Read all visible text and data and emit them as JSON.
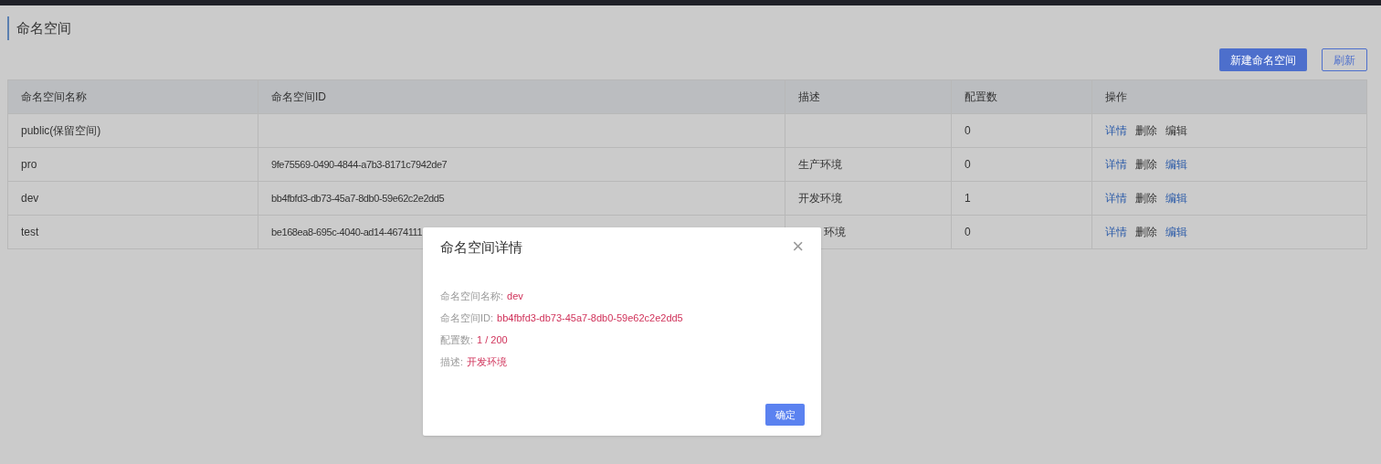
{
  "page": {
    "title": "命名空间"
  },
  "toolbar": {
    "buttons": [
      {
        "label": "新建命名空间",
        "kind": "primary"
      },
      {
        "label": "刷新",
        "kind": "outline"
      }
    ]
  },
  "table": {
    "columns": [
      "命名空间名称",
      "命名空间ID",
      "描述",
      "配置数",
      "操作"
    ],
    "rows": [
      {
        "name": "public(保留空间)",
        "id": "",
        "description": "",
        "count": "0",
        "actions": [
          "详情",
          "删除",
          "编辑"
        ]
      },
      {
        "name": "pro",
        "id": "9fe75569-0490-4844-a7b3-8171c7942de7",
        "description": "生产环境",
        "count": "0",
        "actions": [
          "详情",
          "删除",
          "编辑"
        ]
      },
      {
        "name": "dev",
        "id": "bb4fbfd3-db73-45a7-8db0-59e62c2e2dd5",
        "description": "开发环境",
        "count": "1",
        "actions": [
          "详情",
          "删除",
          "编辑"
        ]
      },
      {
        "name": "test",
        "id": "be168ea8-695c-4040-ad14-4674111",
        "description": "环境",
        "count": "0",
        "actions": [
          "详情",
          "删除",
          "编辑"
        ],
        "covered": true
      }
    ]
  },
  "dialog": {
    "title": "命名空间详情",
    "close": "×",
    "fields": [
      {
        "label": "命名空间名称:",
        "value": "dev"
      },
      {
        "label": "命名空间ID:",
        "value": "bb4fbfd3-db73-45a7-8db0-59e62c2e2dd5"
      },
      {
        "label": "配置数:",
        "value": "1 / 200"
      },
      {
        "label": "描述:",
        "value": "开发环境"
      }
    ],
    "ok": "确定"
  }
}
